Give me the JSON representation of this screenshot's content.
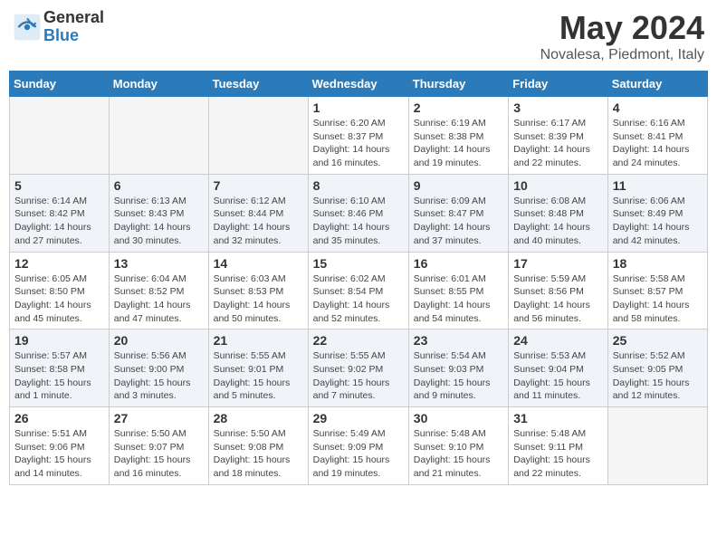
{
  "logo": {
    "general": "General",
    "blue": "Blue"
  },
  "title": {
    "month": "May 2024",
    "location": "Novalesa, Piedmont, Italy"
  },
  "days_of_week": [
    "Sunday",
    "Monday",
    "Tuesday",
    "Wednesday",
    "Thursday",
    "Friday",
    "Saturday"
  ],
  "weeks": [
    [
      {
        "day": "",
        "info": ""
      },
      {
        "day": "",
        "info": ""
      },
      {
        "day": "",
        "info": ""
      },
      {
        "day": "1",
        "info": "Sunrise: 6:20 AM\nSunset: 8:37 PM\nDaylight: 14 hours and 16 minutes."
      },
      {
        "day": "2",
        "info": "Sunrise: 6:19 AM\nSunset: 8:38 PM\nDaylight: 14 hours and 19 minutes."
      },
      {
        "day": "3",
        "info": "Sunrise: 6:17 AM\nSunset: 8:39 PM\nDaylight: 14 hours and 22 minutes."
      },
      {
        "day": "4",
        "info": "Sunrise: 6:16 AM\nSunset: 8:41 PM\nDaylight: 14 hours and 24 minutes."
      }
    ],
    [
      {
        "day": "5",
        "info": "Sunrise: 6:14 AM\nSunset: 8:42 PM\nDaylight: 14 hours and 27 minutes."
      },
      {
        "day": "6",
        "info": "Sunrise: 6:13 AM\nSunset: 8:43 PM\nDaylight: 14 hours and 30 minutes."
      },
      {
        "day": "7",
        "info": "Sunrise: 6:12 AM\nSunset: 8:44 PM\nDaylight: 14 hours and 32 minutes."
      },
      {
        "day": "8",
        "info": "Sunrise: 6:10 AM\nSunset: 8:46 PM\nDaylight: 14 hours and 35 minutes."
      },
      {
        "day": "9",
        "info": "Sunrise: 6:09 AM\nSunset: 8:47 PM\nDaylight: 14 hours and 37 minutes."
      },
      {
        "day": "10",
        "info": "Sunrise: 6:08 AM\nSunset: 8:48 PM\nDaylight: 14 hours and 40 minutes."
      },
      {
        "day": "11",
        "info": "Sunrise: 6:06 AM\nSunset: 8:49 PM\nDaylight: 14 hours and 42 minutes."
      }
    ],
    [
      {
        "day": "12",
        "info": "Sunrise: 6:05 AM\nSunset: 8:50 PM\nDaylight: 14 hours and 45 minutes."
      },
      {
        "day": "13",
        "info": "Sunrise: 6:04 AM\nSunset: 8:52 PM\nDaylight: 14 hours and 47 minutes."
      },
      {
        "day": "14",
        "info": "Sunrise: 6:03 AM\nSunset: 8:53 PM\nDaylight: 14 hours and 50 minutes."
      },
      {
        "day": "15",
        "info": "Sunrise: 6:02 AM\nSunset: 8:54 PM\nDaylight: 14 hours and 52 minutes."
      },
      {
        "day": "16",
        "info": "Sunrise: 6:01 AM\nSunset: 8:55 PM\nDaylight: 14 hours and 54 minutes."
      },
      {
        "day": "17",
        "info": "Sunrise: 5:59 AM\nSunset: 8:56 PM\nDaylight: 14 hours and 56 minutes."
      },
      {
        "day": "18",
        "info": "Sunrise: 5:58 AM\nSunset: 8:57 PM\nDaylight: 14 hours and 58 minutes."
      }
    ],
    [
      {
        "day": "19",
        "info": "Sunrise: 5:57 AM\nSunset: 8:58 PM\nDaylight: 15 hours and 1 minute."
      },
      {
        "day": "20",
        "info": "Sunrise: 5:56 AM\nSunset: 9:00 PM\nDaylight: 15 hours and 3 minutes."
      },
      {
        "day": "21",
        "info": "Sunrise: 5:55 AM\nSunset: 9:01 PM\nDaylight: 15 hours and 5 minutes."
      },
      {
        "day": "22",
        "info": "Sunrise: 5:55 AM\nSunset: 9:02 PM\nDaylight: 15 hours and 7 minutes."
      },
      {
        "day": "23",
        "info": "Sunrise: 5:54 AM\nSunset: 9:03 PM\nDaylight: 15 hours and 9 minutes."
      },
      {
        "day": "24",
        "info": "Sunrise: 5:53 AM\nSunset: 9:04 PM\nDaylight: 15 hours and 11 minutes."
      },
      {
        "day": "25",
        "info": "Sunrise: 5:52 AM\nSunset: 9:05 PM\nDaylight: 15 hours and 12 minutes."
      }
    ],
    [
      {
        "day": "26",
        "info": "Sunrise: 5:51 AM\nSunset: 9:06 PM\nDaylight: 15 hours and 14 minutes."
      },
      {
        "day": "27",
        "info": "Sunrise: 5:50 AM\nSunset: 9:07 PM\nDaylight: 15 hours and 16 minutes."
      },
      {
        "day": "28",
        "info": "Sunrise: 5:50 AM\nSunset: 9:08 PM\nDaylight: 15 hours and 18 minutes."
      },
      {
        "day": "29",
        "info": "Sunrise: 5:49 AM\nSunset: 9:09 PM\nDaylight: 15 hours and 19 minutes."
      },
      {
        "day": "30",
        "info": "Sunrise: 5:48 AM\nSunset: 9:10 PM\nDaylight: 15 hours and 21 minutes."
      },
      {
        "day": "31",
        "info": "Sunrise: 5:48 AM\nSunset: 9:11 PM\nDaylight: 15 hours and 22 minutes."
      },
      {
        "day": "",
        "info": ""
      }
    ]
  ]
}
